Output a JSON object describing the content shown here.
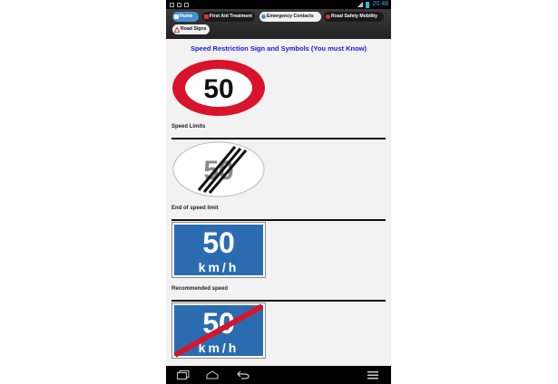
{
  "status": {
    "time": "20:48"
  },
  "tabs": [
    {
      "label": "Home",
      "icon": "home-icon"
    },
    {
      "label": "First Aid Treatment",
      "icon": "first-aid-icon"
    },
    {
      "label": "Emergency Contacts",
      "icon": "phone-icon"
    },
    {
      "label": "Road Safety Mobility",
      "icon": "no-entry-icon"
    },
    {
      "label": "Road Signs",
      "icon": "warning-icon"
    }
  ],
  "page": {
    "title": "Speed Restriction Sign and Symbols (You must Know)"
  },
  "signs": [
    {
      "label": "Speed Limits",
      "number": "50"
    },
    {
      "label": "End of speed limit",
      "number": "50"
    },
    {
      "label": "Recommended speed",
      "number": "50",
      "unit": "km/h"
    },
    {
      "label": "",
      "number": "50",
      "unit": "km/h"
    }
  ],
  "colors": {
    "accent": "#1a1ae0",
    "tab_active": "#4a8fd0",
    "sign_red": "#d7142b",
    "sign_blue": "#2b6cb0"
  }
}
